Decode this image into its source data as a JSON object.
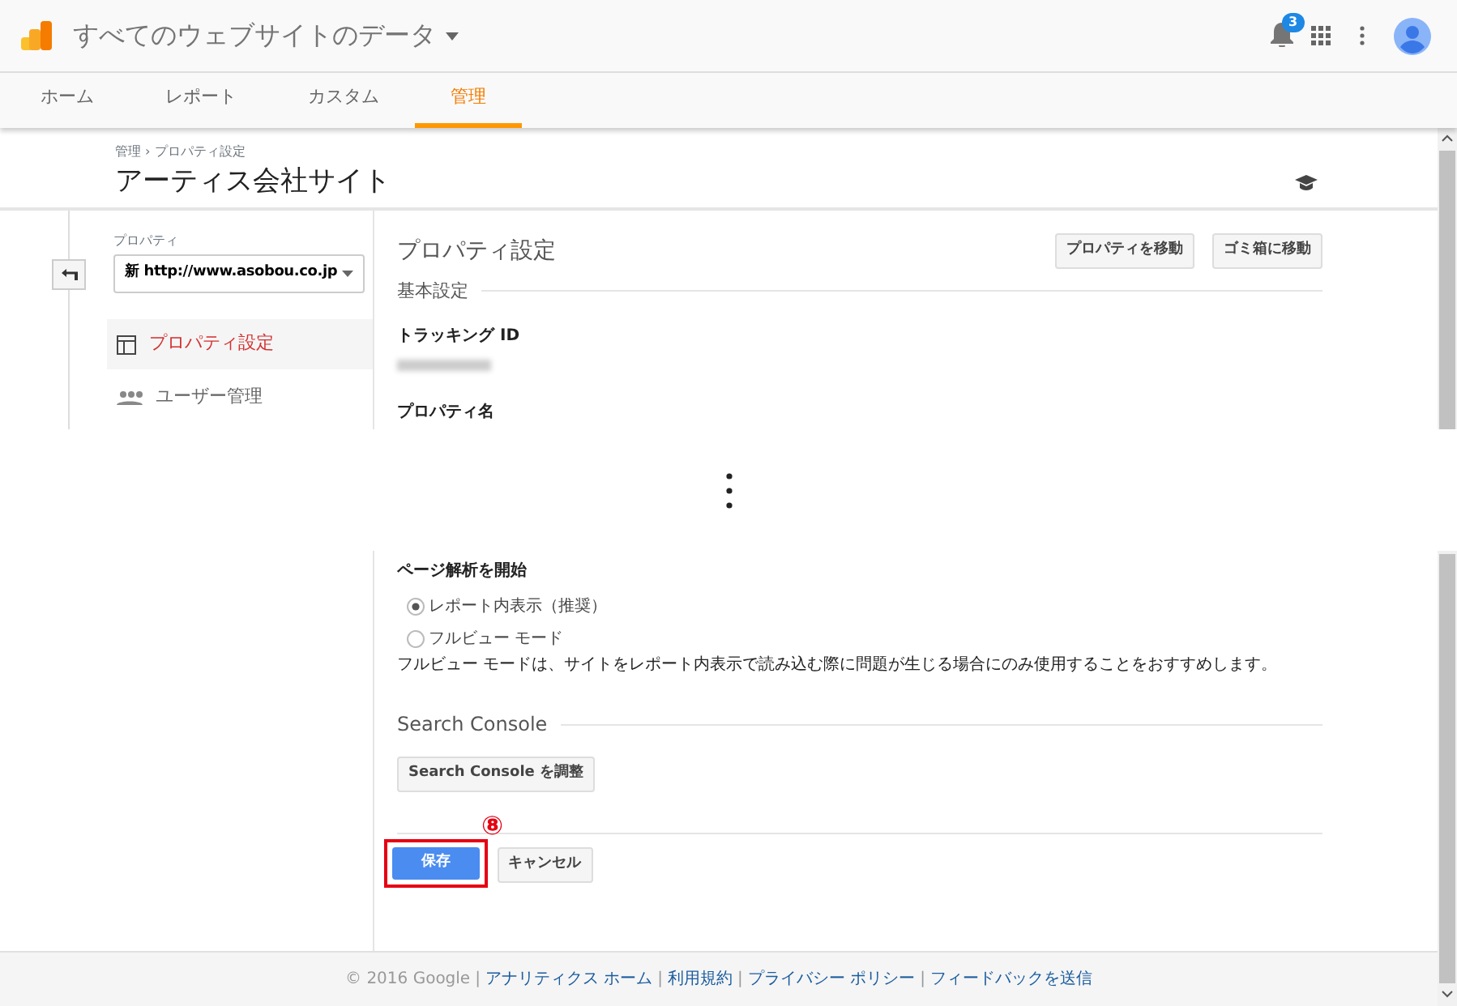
{
  "header": {
    "title": "すべてのウェブサイトのデータ",
    "notification_count": "3"
  },
  "tabs": [
    {
      "label": "ホーム",
      "selected": false
    },
    {
      "label": "レポート",
      "selected": false
    },
    {
      "label": "カスタム",
      "selected": false
    },
    {
      "label": "管理",
      "selected": true
    }
  ],
  "breadcrumb": "管理 › プロパティ設定",
  "page_title": "アーティス会社サイト",
  "sidebar": {
    "property_label": "プロパティ",
    "property_select": "新 http://www.asobou.co.jp",
    "items": [
      {
        "label": "プロパティ設定",
        "selected": true
      },
      {
        "label": "ユーザー管理",
        "selected": false
      }
    ]
  },
  "main": {
    "title": "プロパティ設定",
    "buttons": [
      "プロパティを移動",
      "ゴミ箱に移動"
    ],
    "section": "基本設定",
    "fields": [
      "トラッキング ID",
      "プロパティ名"
    ]
  },
  "page_analysis": {
    "label": "ページ解析を開始",
    "options": [
      {
        "label": "レポート内表示（推奨）",
        "selected": true
      },
      {
        "label": "フルビュー モード",
        "selected": false
      }
    ],
    "note": "フルビュー モードは、サイトをレポート内表示で読み込む際に問題が生じる場合にのみ使用することをおすすめします。"
  },
  "search_console": {
    "title": "Search Console",
    "button": "Search Console を調整"
  },
  "actions": {
    "save": "保存",
    "cancel": "キャンセル"
  },
  "annotation": "⑧",
  "footer": {
    "copyright": "© 2016 Google",
    "separator": "|",
    "links": [
      "アナリティクス ホーム",
      "利用規約",
      "プライバシー ポリシー",
      "フィードバックを送信"
    ]
  }
}
